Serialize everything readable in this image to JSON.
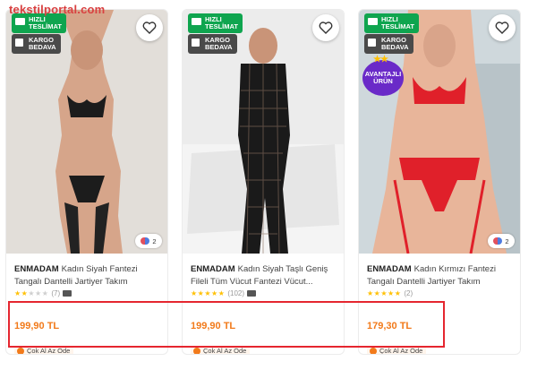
{
  "watermark": "tekstilportal.com",
  "badges": {
    "fast_line1": "HIZLI",
    "fast_line2": "TESLİMAT",
    "cargo_line1": "KARGO",
    "cargo_line2": "BEDAVA",
    "advantage_line1": "AVANTAJLI",
    "advantage_line2": "ÜRÜN"
  },
  "colors": {
    "accent": "#f27a1a",
    "fast_green": "#0fa54f",
    "highlight_red": "#e5262f",
    "advantage_purple": "#6a2ac8"
  },
  "products": [
    {
      "brand": "ENMADAM",
      "title": "Kadın Siyah Fantezi Tangalı Dantelli Jartiyer Takım",
      "rating_stars": 2,
      "review_count": "(7)",
      "color_count": "2",
      "price": "199,90 TL",
      "promo": "Çok Al Az Öde"
    },
    {
      "brand": "ENMADAM",
      "title": "Kadın Siyah Taşlı Geniş Fileli Tüm Vücut Fantezi Vücut...",
      "rating_stars": 4.5,
      "review_count": "(102)",
      "price": "199,90 TL",
      "promo": "Çok Al Az Öde"
    },
    {
      "brand": "ENMADAM",
      "title": "Kadın Kırmızı Fantezi Tangalı Dantelli Jartiyer Takım",
      "rating_stars": 5,
      "review_count": "(2)",
      "color_count": "2",
      "price": "179,30 TL",
      "promo": "Çok Al Az Öde"
    }
  ]
}
